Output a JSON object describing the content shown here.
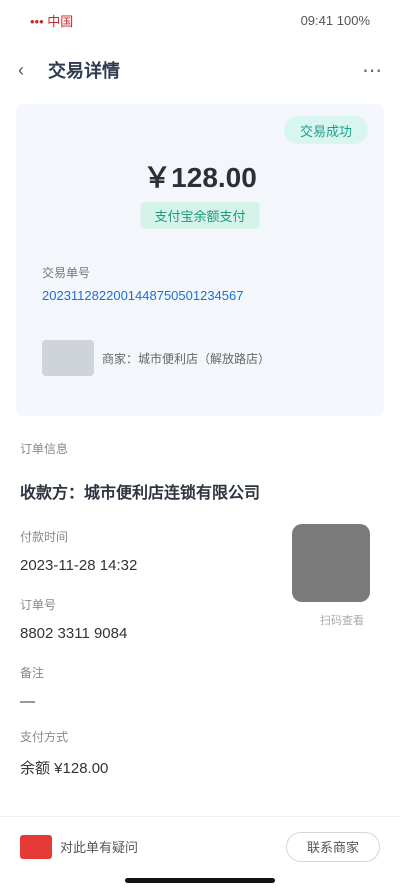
{
  "status_bar": {
    "carrier": "••• 中国",
    "time": "09:41",
    "indicators": "100%"
  },
  "nav": {
    "title": "交易详情",
    "back_icon": "chevron-left-icon",
    "more_icon": "more-dots-icon"
  },
  "summary": {
    "status": "交易成功",
    "amount": "￥128.00",
    "note": "支付宝余额支付",
    "label": "交易单号",
    "link": "2023112822001448750501234567",
    "row_text": "商家：城市便利店（解放路店）"
  },
  "detail": {
    "section_label": "订单信息",
    "heading": "收款方：城市便利店连锁有限公司",
    "items": [
      {
        "key": "付款时间",
        "value": "2023-11-28 14:32"
      },
      {
        "key": "订单号",
        "value": "8802 3311 9084"
      },
      {
        "key": "备注",
        "value": "—"
      },
      {
        "key": "支付方式",
        "value": "余额 ¥128.00"
      }
    ]
  },
  "qr": {
    "caption": "扫码查看"
  },
  "bottom_bar": {
    "left_label": "对此单有疑问",
    "right_button": "联系商家"
  }
}
